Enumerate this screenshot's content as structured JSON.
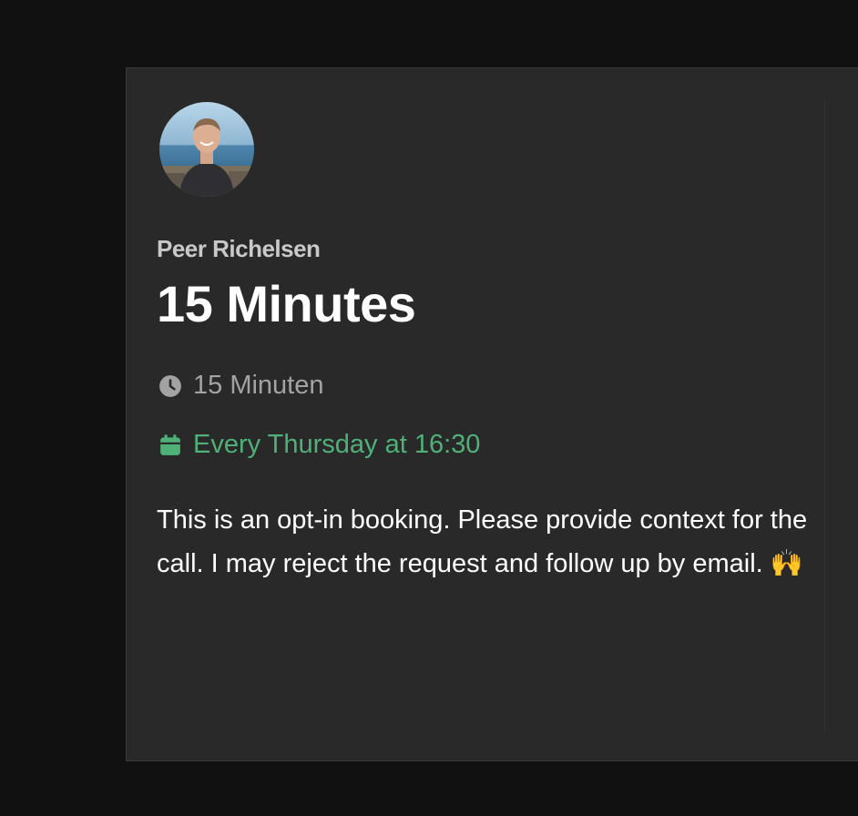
{
  "host": {
    "name": "Peer Richelsen",
    "avatar_icon": "avatar-photo"
  },
  "event": {
    "title": "15 Minutes",
    "duration": "15 Minuten",
    "duration_icon": "clock-icon",
    "schedule": "Every Thursday at 16:30",
    "schedule_icon": "calendar-icon",
    "description": "This is an opt-in booking. Please provide context for the call. I may reject the request and follow up by email. 🙌"
  },
  "colors": {
    "background": "#111111",
    "card": "#292929",
    "schedule_accent": "#4fb078",
    "muted_text": "#a3a3a3"
  }
}
